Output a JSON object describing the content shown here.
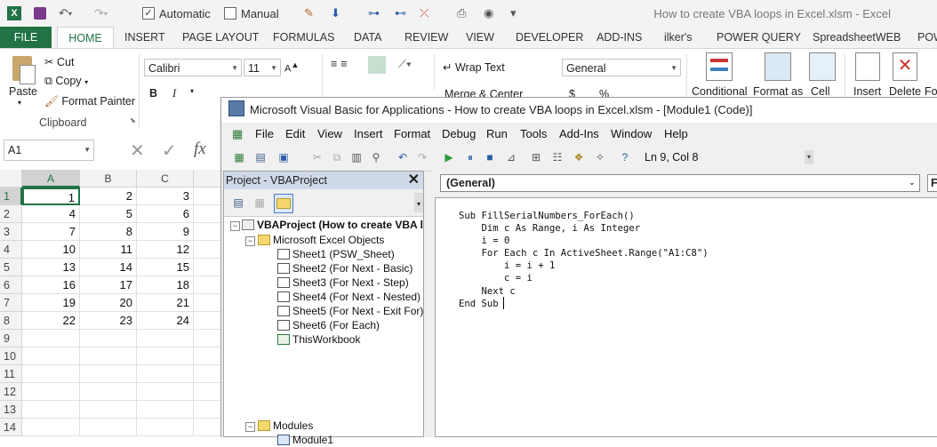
{
  "excel": {
    "title": "How to create VBA loops in Excel.xlsm - Excel",
    "qat": {
      "automatic": "Automatic",
      "manual": "Manual",
      "automatic_checked": true,
      "manual_checked": false
    },
    "tabs": [
      "FILE",
      "HOME",
      "INSERT",
      "PAGE LAYOUT",
      "FORMULAS",
      "DATA",
      "REVIEW",
      "VIEW",
      "DEVELOPER",
      "ADD-INS",
      "ilker's",
      "POWER QUERY",
      "SpreadsheetWEB",
      "POW"
    ],
    "ribbon": {
      "paste": "Paste",
      "cut": "Cut",
      "copy": "Copy",
      "format_painter": "Format Painter",
      "clipboard": "Clipboard",
      "font_name": "Calibri",
      "font_size": "11",
      "bold": "B",
      "italic": "I",
      "wrap_text": "Wrap Text",
      "merge_center": "Merge & Center",
      "number_format": "General",
      "currency": "$",
      "percent": "%",
      "conditional": "Conditional",
      "format_as": "Format as",
      "cell": "Cell",
      "insert": "Insert",
      "delete": "Delete",
      "format_short": "Fo"
    },
    "name_box": "A1",
    "formula_icons": {
      "cancel": "✕",
      "enter": "✓",
      "fx": "fx"
    },
    "columns": [
      "A",
      "B",
      "C"
    ],
    "rows": [
      "1",
      "2",
      "3",
      "4",
      "5",
      "6",
      "7",
      "8",
      "9",
      "10",
      "11",
      "12",
      "13",
      "14"
    ],
    "cells": [
      [
        "1",
        "2",
        "3"
      ],
      [
        "4",
        "5",
        "6"
      ],
      [
        "7",
        "8",
        "9"
      ],
      [
        "10",
        "11",
        "12"
      ],
      [
        "13",
        "14",
        "15"
      ],
      [
        "16",
        "17",
        "18"
      ],
      [
        "19",
        "20",
        "21"
      ],
      [
        "22",
        "23",
        "24"
      ]
    ]
  },
  "vbe": {
    "title": "Microsoft Visual Basic for Applications - How to create VBA loops in Excel.xlsm - [Module1 (Code)]",
    "menu": [
      "File",
      "Edit",
      "View",
      "Insert",
      "Format",
      "Debug",
      "Run",
      "Tools",
      "Add-Ins",
      "Window",
      "Help"
    ],
    "cursor_pos": "Ln 9, Col 8",
    "project_title": "Project - VBAProject",
    "tree": {
      "root": "VBAProject (How to create VBA l",
      "excel_objects": "Microsoft Excel Objects",
      "sheets": [
        "Sheet1 (PSW_Sheet)",
        "Sheet2 (For Next - Basic)",
        "Sheet3 (For Next - Step)",
        "Sheet4 (For Next - Nested)",
        "Sheet5 (For Next - Exit For)",
        "Sheet6 (For Each)",
        "ThisWorkbook"
      ],
      "modules": "Modules",
      "module1": "Module1"
    },
    "object_dropdown": "(General)",
    "proc_dropdown": "F",
    "code": "Sub FillSerialNumbers_ForEach()\n    Dim c As Range, i As Integer\n    i = 0\n    For Each c In ActiveSheet.Range(\"A1:C8\")\n        i = i + 1\n        c = i\n    Next c\nEnd Sub"
  },
  "colors": {
    "excel_green": "#217346",
    "project_header": "#cfd9e8"
  }
}
